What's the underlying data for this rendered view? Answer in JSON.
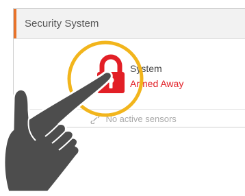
{
  "card": {
    "title": "Security System",
    "accent_color": "#e8732a"
  },
  "status": {
    "label": "System",
    "value": "Armed Away",
    "value_color": "#e21f26",
    "icon": "lock-icon",
    "icon_color": "#e21f26"
  },
  "sensors": {
    "icon": "link-icon",
    "text": "No active sensors"
  },
  "overlay": {
    "highlight_color": "#f2b51c",
    "hand_color": "#4d4d4d",
    "hand_icon": "pointing-hand-icon"
  }
}
